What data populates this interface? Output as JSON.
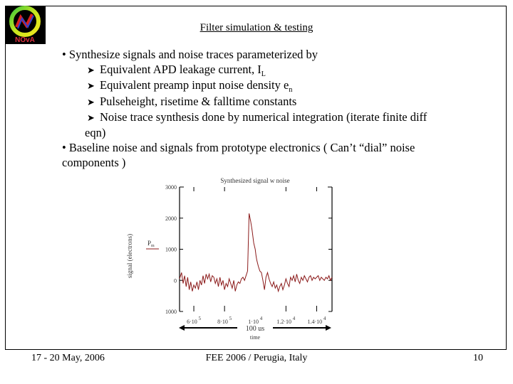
{
  "slide": {
    "title": "Filter simulation & testing",
    "logo": {
      "icon": "nova-logo",
      "text": "NOvA"
    },
    "bullets": [
      {
        "level": 1,
        "marker": "•",
        "text": "Synthesize signals and noise traces parameterized by"
      },
      {
        "level": 2,
        "marker": "Ø",
        "text": "Equivalent APD leakage current, I",
        "subscript": "L"
      },
      {
        "level": 2,
        "marker": "Ø",
        "text": "Equivalent preamp input noise density e",
        "subscript": "n"
      },
      {
        "level": 2,
        "marker": "Ø",
        "text": "Pulseheight, risetime & falltime constants"
      },
      {
        "level": 2,
        "marker": "Ø",
        "text": "Noise trace synthesis done by numerical integration (iterate finite diff",
        "continuation": "eqn)"
      },
      {
        "level": 1,
        "marker": "•",
        "text": "Baseline noise and signals from prototype electronics ( Can’t “dial” noise",
        "continuation": "components )"
      }
    ],
    "footer": {
      "left": "17 - 20 May, 2006",
      "center": "FEE 2006 / Perugia, Italy",
      "right": "10"
    }
  },
  "chart_data": {
    "type": "line",
    "title": "Synthesized signal w noise",
    "xlabel": "time",
    "ylabel": "signal (electrons)",
    "legend": [
      {
        "label": "P",
        "subscript": "m",
        "color": "#8b1a1a"
      }
    ],
    "legend_placement": "left-outside",
    "annotation": "100 us",
    "xlim": [
      5.07e-05,
      0.00015
    ],
    "ylim": [
      -1000,
      3000
    ],
    "xticks": [
      6e-05,
      8e-05,
      0.0001,
      0.00012,
      0.00014
    ],
    "xtick_labels": [
      {
        "mant": "6·10",
        "exp": "-5"
      },
      {
        "mant": "8·10",
        "exp": "-5"
      },
      {
        "mant": "1·10",
        "exp": "-4"
      },
      {
        "mant": "1.2·10",
        "exp": "-4"
      },
      {
        "mant": "1.4·10",
        "exp": "-4"
      }
    ],
    "yticks": [
      -1000,
      0,
      1000,
      2000,
      3000
    ],
    "ytick_labels": [
      "1000",
      "0",
      "1000",
      "2000",
      "3000"
    ],
    "grid": false,
    "series": [
      {
        "name": "Pm",
        "color": "#8b1a1a",
        "x": [
          5.07e-05,
          5.2e-05,
          5.3e-05,
          5.4e-05,
          5.5e-05,
          5.6e-05,
          5.7e-05,
          5.8e-05,
          5.9e-05,
          6e-05,
          6.1e-05,
          6.2e-05,
          6.3e-05,
          6.4e-05,
          6.5e-05,
          6.6e-05,
          6.7e-05,
          6.8e-05,
          6.9e-05,
          7e-05,
          7.1e-05,
          7.2e-05,
          7.3e-05,
          7.4e-05,
          7.5e-05,
          7.6e-05,
          7.7e-05,
          7.8e-05,
          7.9e-05,
          8e-05,
          8.1e-05,
          8.2e-05,
          8.3e-05,
          8.4e-05,
          8.5e-05,
          8.6e-05,
          8.7e-05,
          8.8e-05,
          8.9e-05,
          9e-05,
          9.1e-05,
          9.2e-05,
          9.3e-05,
          9.4e-05,
          9.5e-05,
          9.6e-05,
          9.7e-05,
          9.8e-05,
          9.9e-05,
          0.0001,
          0.0001005,
          0.000101,
          0.000102,
          0.000103,
          0.000104,
          0.000105,
          0.000106,
          0.000107,
          0.000108,
          0.000109,
          0.00011,
          0.000111,
          0.000112,
          0.000113,
          0.000114,
          0.000115,
          0.000116,
          0.000117,
          0.000118,
          0.000119,
          0.00012,
          0.000121,
          0.000122,
          0.000123,
          0.000124,
          0.000125,
          0.000126,
          0.000127,
          0.000128,
          0.000129,
          0.00013,
          0.000131,
          0.000132,
          0.000133,
          0.000134,
          0.000135,
          0.000136,
          0.000137,
          0.000138,
          0.000139,
          0.00014,
          0.000141,
          0.000142,
          0.000143,
          0.000144,
          0.000145,
          0.000146,
          0.000147,
          0.000148,
          0.000149,
          0.00015
        ],
        "y": [
          50,
          250,
          -100,
          150,
          -200,
          100,
          -300,
          -50,
          -350,
          -150,
          -250,
          -50,
          -300,
          0,
          -150,
          150,
          -100,
          200,
          50,
          200,
          -50,
          150,
          100,
          -100,
          50,
          -200,
          100,
          -150,
          0,
          -300,
          -100,
          -200,
          50,
          -100,
          -250,
          0,
          -350,
          -150,
          -50,
          -100,
          50,
          100,
          0,
          150,
          300,
          2150,
          1900,
          1600,
          1200,
          1000,
          800,
          650,
          450,
          300,
          250,
          0,
          -300,
          100,
          250,
          50,
          -100,
          -200,
          -50,
          -250,
          -150,
          -350,
          -200,
          -100,
          -300,
          -150,
          50,
          -100,
          -200,
          100,
          0,
          150,
          -50,
          200,
          0,
          -100,
          100,
          0,
          150,
          50,
          -50,
          100,
          150,
          0,
          100,
          50,
          100,
          150,
          0,
          100,
          50,
          0,
          100,
          50,
          150,
          0,
          100
        ]
      }
    ]
  }
}
